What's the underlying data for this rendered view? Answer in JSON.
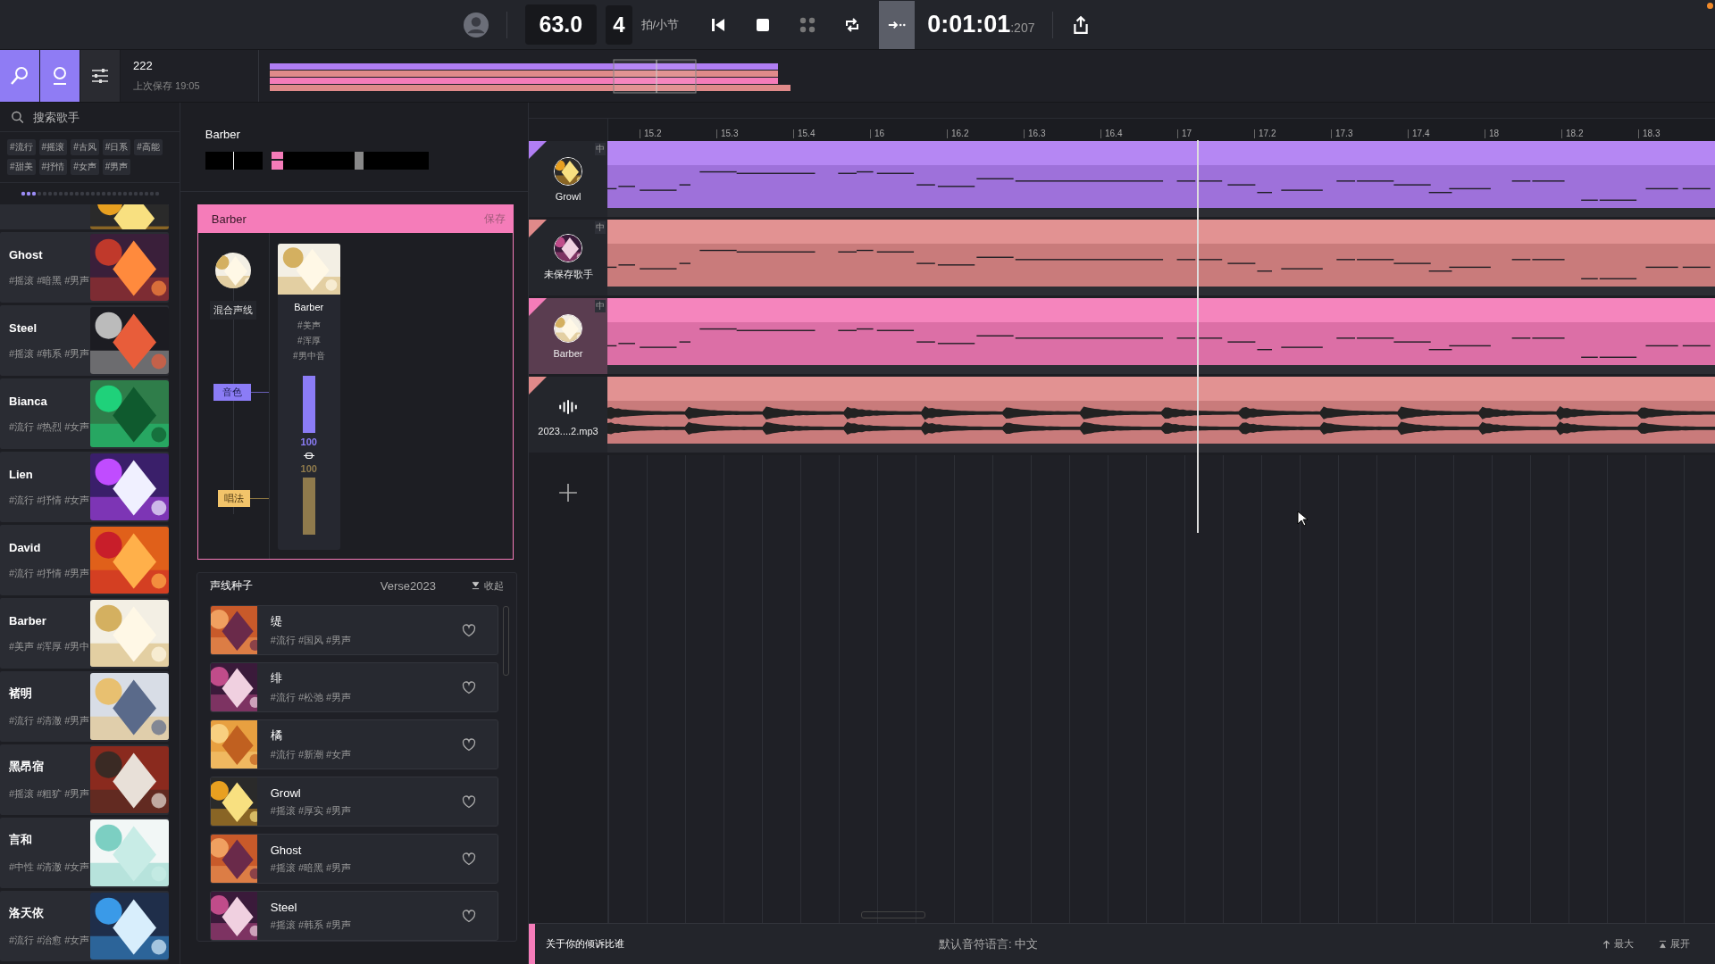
{
  "topbar": {
    "tempo": "63.0",
    "beats": "4",
    "beats_unit": "拍/小节",
    "time": "0:01:01",
    "time_ms": ":207",
    "notification": true,
    "transport": [
      {
        "kind": "prev",
        "active": false
      },
      {
        "kind": "stop",
        "active": false
      },
      {
        "kind": "grid",
        "active": false
      },
      {
        "kind": "loop",
        "active": false
      },
      {
        "kind": "follow",
        "active": true
      }
    ]
  },
  "modes": [
    {
      "kind": "singer",
      "selected": true
    },
    {
      "kind": "person",
      "selected": true
    },
    {
      "kind": "mixer",
      "selected": false
    }
  ],
  "project": {
    "name": "222",
    "saved": "上次保存 19:05"
  },
  "sidebar": {
    "search": {
      "placeholder": "搜索歌手"
    },
    "tags": [
      "#流行",
      "#摇滚",
      "#古风",
      "#日系",
      "#高能",
      "#甜美",
      "#抒情",
      "#女声",
      "#男声"
    ],
    "singers": [
      {
        "name": "Ghost",
        "tags": "#摇滚 #暗黑 #男声"
      },
      {
        "name": "Steel",
        "tags": "#摇滚 #韩系 #男声"
      },
      {
        "name": "Bianca",
        "tags": "#流行 #热烈 #女声"
      },
      {
        "name": "Lien",
        "tags": "#流行 #抒情 #女声"
      },
      {
        "name": "David",
        "tags": "#流行 #抒情 #男声"
      },
      {
        "name": "Barber",
        "tags": "#美声 #浑厚 #男中"
      },
      {
        "name": "褚明",
        "tags": "#流行 #清澈 #男声"
      },
      {
        "name": "黑昂宿",
        "tags": "#摇滚 #粗犷 #男声"
      },
      {
        "name": "言和",
        "tags": "#中性 #清澈 #女声"
      },
      {
        "name": "洛天依",
        "tags": "#流行 #治愈 #女声"
      }
    ]
  },
  "mix": {
    "title": "Barber",
    "card": {
      "title": "Barber",
      "save": "保存",
      "mix_label": "混合声线",
      "timbre_label": "音色",
      "style_label": "唱法",
      "voice": {
        "name": "Barber",
        "tags": [
          "#美声",
          "#浑厚",
          "#男中音"
        ],
        "timbre": {
          "level": 1,
          "reading": "100"
        },
        "style": {
          "level": 1,
          "reading": "100"
        }
      }
    }
  },
  "seeds": {
    "title": "声线种子",
    "version": "Verse2023",
    "collapse": "收起",
    "items": [
      {
        "name": "缇",
        "tags": "#流行 #国风 #男声",
        "liked": false
      },
      {
        "name": "绯",
        "tags": "#流行 #松弛 #男声",
        "liked": false
      },
      {
        "name": "橘",
        "tags": "#流行 #新潮 #女声",
        "liked": false
      },
      {
        "name": "Growl",
        "tags": "#摇滚 #厚实 #男声",
        "liked": false
      },
      {
        "name": "Ghost",
        "tags": "#摇滚 #暗黑 #男声",
        "liked": false
      },
      {
        "name": "Steel",
        "tags": "#摇滚 #韩系 #男声",
        "liked": false
      }
    ]
  },
  "ruler": [
    "15.2",
    "15.3",
    "15.4",
    "16",
    "16.2",
    "16.3",
    "16.4",
    "17",
    "17.2",
    "17.3",
    "17.4",
    "18",
    "18.2",
    "18.3"
  ],
  "tracks": [
    {
      "kind": "voice",
      "name": "Growl",
      "lang": "中",
      "color": "#b07ef3",
      "selected": false
    },
    {
      "kind": "voice",
      "name": "未保存歌手",
      "lang": "中",
      "color": "#e08a8a",
      "selected": false
    },
    {
      "kind": "voice",
      "name": "Barber",
      "lang": "中",
      "color": "#f57cb9",
      "selected": true
    },
    {
      "kind": "audio",
      "name": "2023....2.mp3",
      "color": "#e08a8a",
      "selected": false
    }
  ],
  "bottom": {
    "lyric": "关于你的倾诉比谁",
    "language": "默认音符语言: 中文",
    "max": "最大",
    "expand": "展开"
  }
}
